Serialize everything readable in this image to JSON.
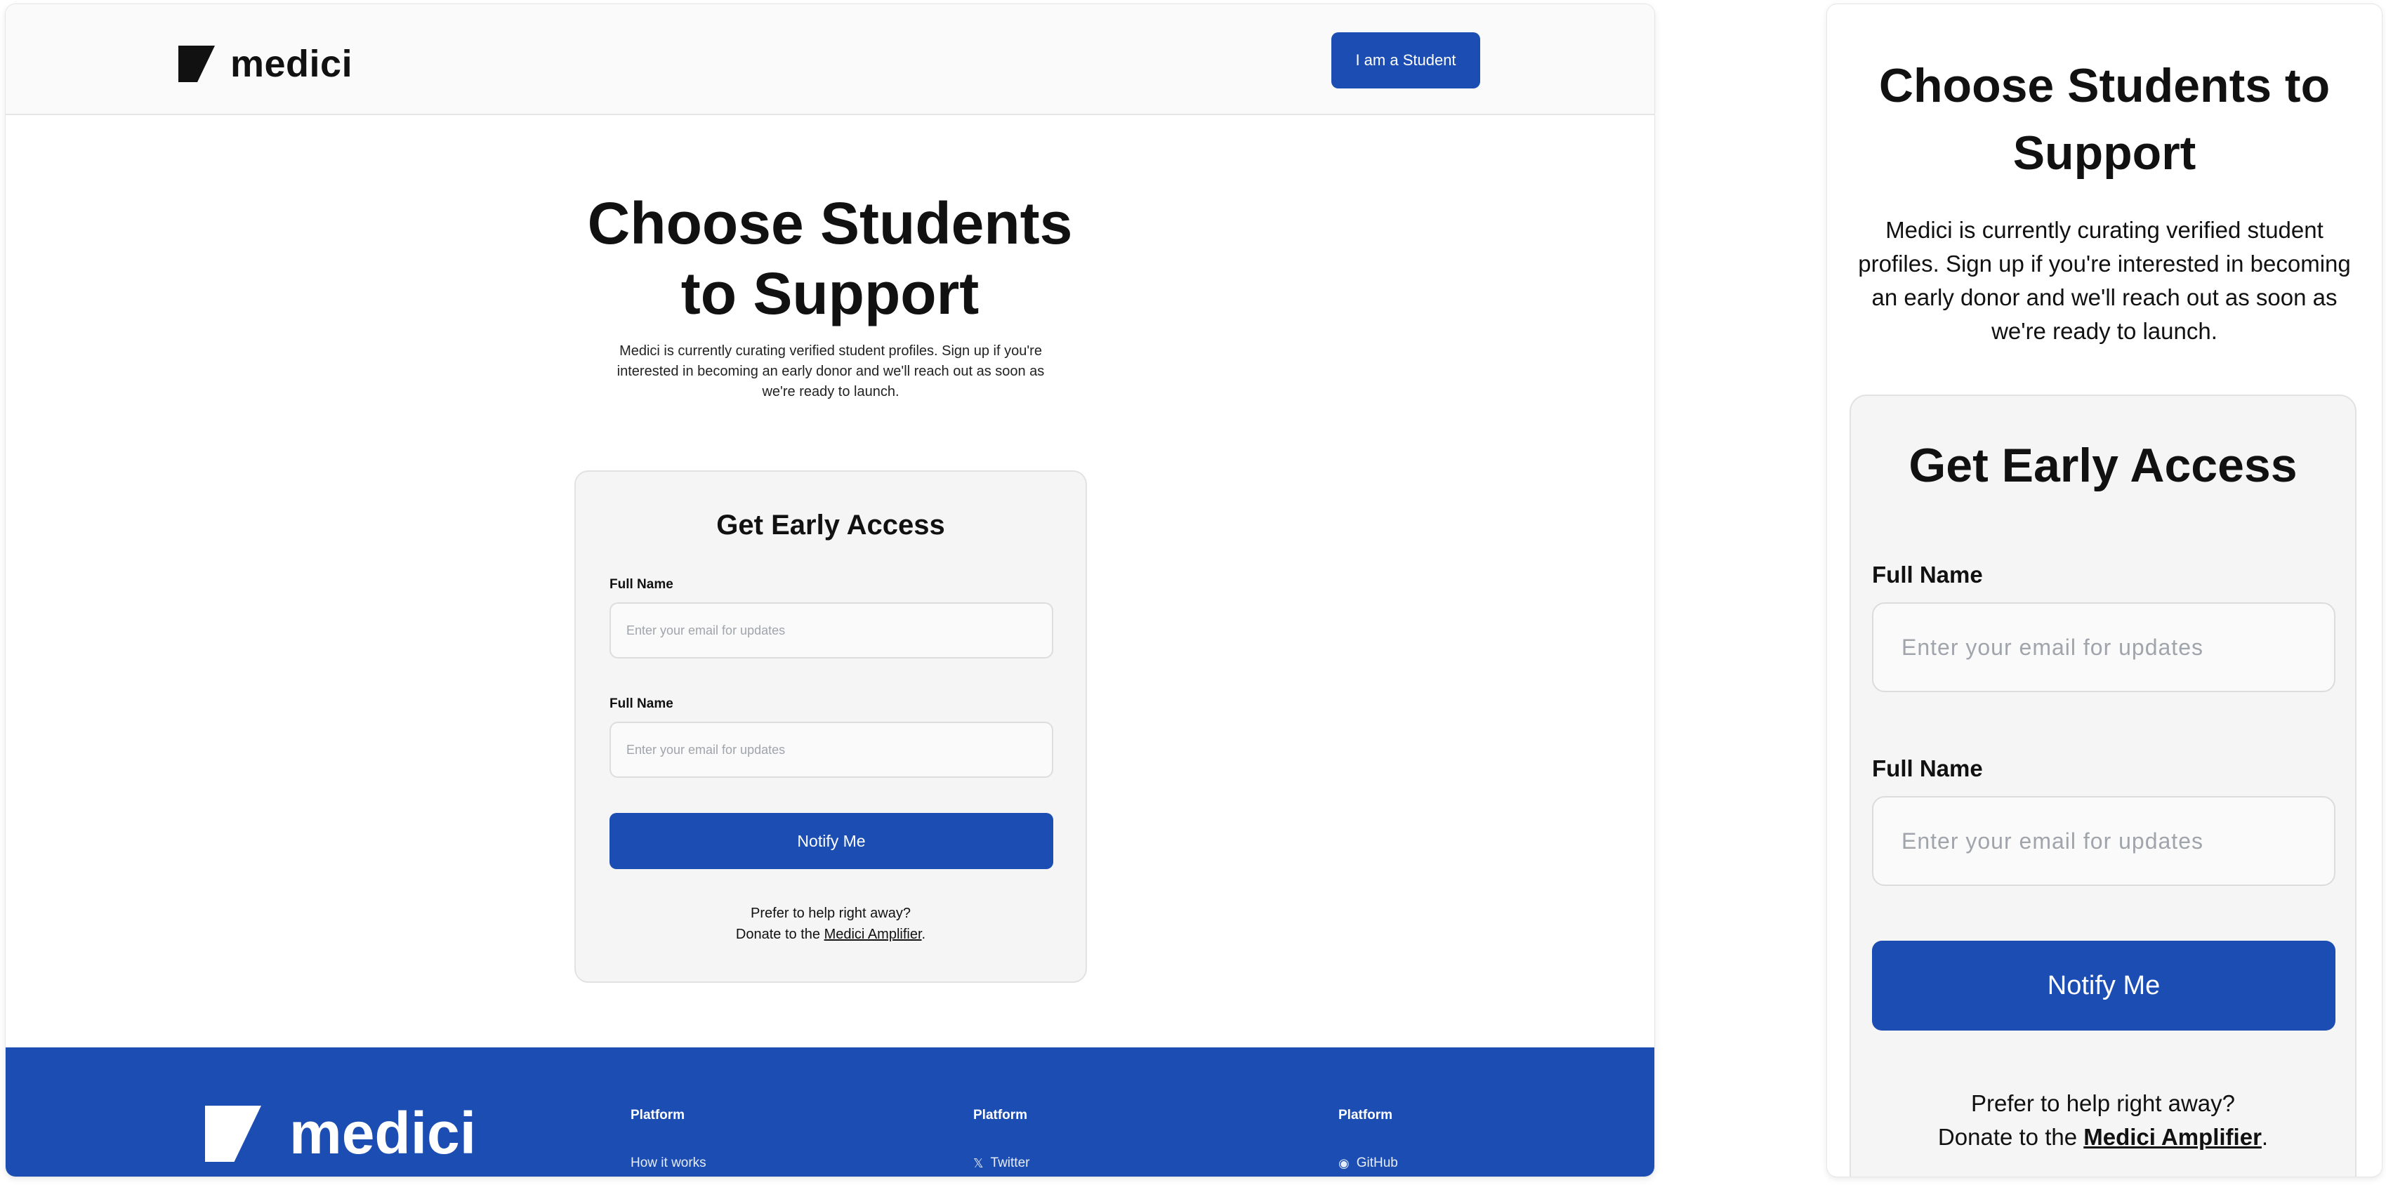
{
  "brand": {
    "name": "medici"
  },
  "header": {
    "cta_label": "I am a Student"
  },
  "hero": {
    "title_line1": "Choose Students",
    "title_line2": "to Support",
    "mobile_title_line1": "Choose Students to",
    "mobile_title_line2": "Support",
    "subtitle": "Medici is currently curating verified student profiles. Sign up if you're interested in becoming an early donor and we'll reach out as soon as we're ready to launch."
  },
  "form": {
    "title": "Get Early Access",
    "fields": [
      {
        "label": "Full Name",
        "placeholder": "Enter your email for updates",
        "value": ""
      },
      {
        "label": "Full Name",
        "placeholder": "Enter your email for updates",
        "value": ""
      }
    ],
    "submit_label": "Notify Me",
    "help_line1": "Prefer to help right away?",
    "help_prefix": "Donate to the ",
    "help_link": "Medici Amplifier",
    "help_suffix": "."
  },
  "footer": {
    "columns": [
      {
        "heading": "Platform",
        "link": "How it works",
        "icon": ""
      },
      {
        "heading": "Platform",
        "link": "Twitter",
        "icon": "x-logo-icon"
      },
      {
        "heading": "Platform",
        "link": "GitHub",
        "icon": "github-icon"
      }
    ]
  },
  "colors": {
    "primary": "#1b4db3",
    "header_bg": "#fafafa",
    "card_bg": "#f5f5f5",
    "text": "#111111"
  }
}
